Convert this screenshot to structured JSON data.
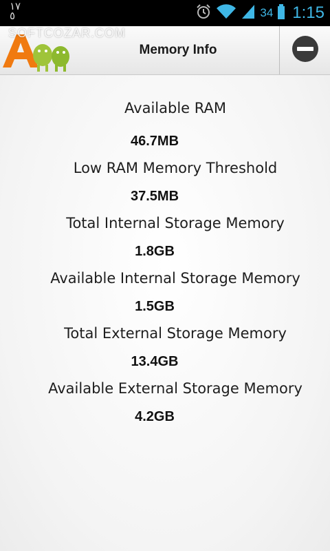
{
  "status_bar": {
    "left_text": "١٧\n٥",
    "battery_level": "34",
    "clock": "1:15",
    "icons": [
      "alarm-icon",
      "wifi-icon",
      "signal-icon",
      "battery-icon"
    ],
    "accent_color": "#3fb7e6"
  },
  "action_bar": {
    "watermark": "SOFTCOZAR.COM",
    "title": "Memory Info",
    "close_icon": "minus-circle-icon"
  },
  "memory": {
    "available_ram": {
      "label": "Available RAM",
      "value": "46.7MB"
    },
    "low_ram_threshold": {
      "label": "Low RAM Memory Threshold",
      "value": "37.5MB"
    },
    "total_internal": {
      "label": "Total Internal Storage Memory",
      "value": "1.8GB"
    },
    "available_internal": {
      "label": "Available Internal Storage Memory",
      "value": "1.5GB"
    },
    "total_external": {
      "label": "Total External Storage Memory",
      "value": "13.4GB"
    },
    "available_external": {
      "label": "Available External Storage Memory",
      "value": "4.2GB"
    }
  }
}
